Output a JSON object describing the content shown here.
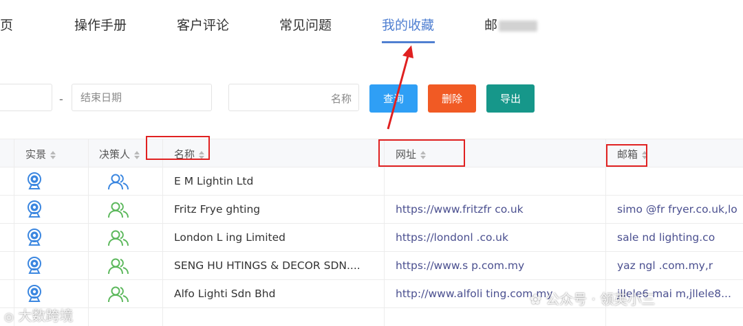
{
  "nav": {
    "tabs": [
      "页",
      "操作手册",
      "客户评论",
      "常见问题",
      "我的收藏",
      "邮"
    ],
    "active_index": 4
  },
  "filters": {
    "end_date_placeholder": "结束日期",
    "range_separator": "-",
    "name_label": "名称",
    "query_button": "查询",
    "delete_button": "删除",
    "export_button": "导出"
  },
  "table": {
    "headers": [
      "实景",
      "决策人",
      "名称",
      "网址",
      "邮箱"
    ],
    "rows": [
      {
        "name": "E M Lightin  Ltd",
        "website": "",
        "email": "",
        "decision_maker_color": "blue"
      },
      {
        "name": "Fritz Frye  ghting",
        "website": "https://www.fritzfr  co.uk",
        "email": "simo  @fr  fryer.co.uk,lo",
        "decision_maker_color": "green"
      },
      {
        "name": "London L  ing Limited",
        "website": "https://londonl  .co.uk",
        "email": "sale  nd  lighting.co",
        "decision_maker_color": "green"
      },
      {
        "name": "SENG HU  HTINGS & DECOR SDN....",
        "website": "https://www.s  p.com.my",
        "email": "yaz  ngl  .com.my,r",
        "decision_maker_color": "green"
      },
      {
        "name": "Alfo Lighti  Sdn Bhd",
        "website": "http://www.alfoli  ting.com.my",
        "email": "jllele6  mai  m,jllele8...",
        "decision_maker_color": "green"
      }
    ]
  },
  "watermarks": {
    "left": "大数跨境",
    "right": "公众号 · 领英小三"
  },
  "colors": {
    "accent": "#4f7fd1",
    "query_button": "#2f9ff5",
    "delete_button": "#f15a24",
    "export_button": "#16978a",
    "annotation": "#e02020",
    "icon_blue": "#3a86e0",
    "icon_green": "#5cb85c"
  }
}
